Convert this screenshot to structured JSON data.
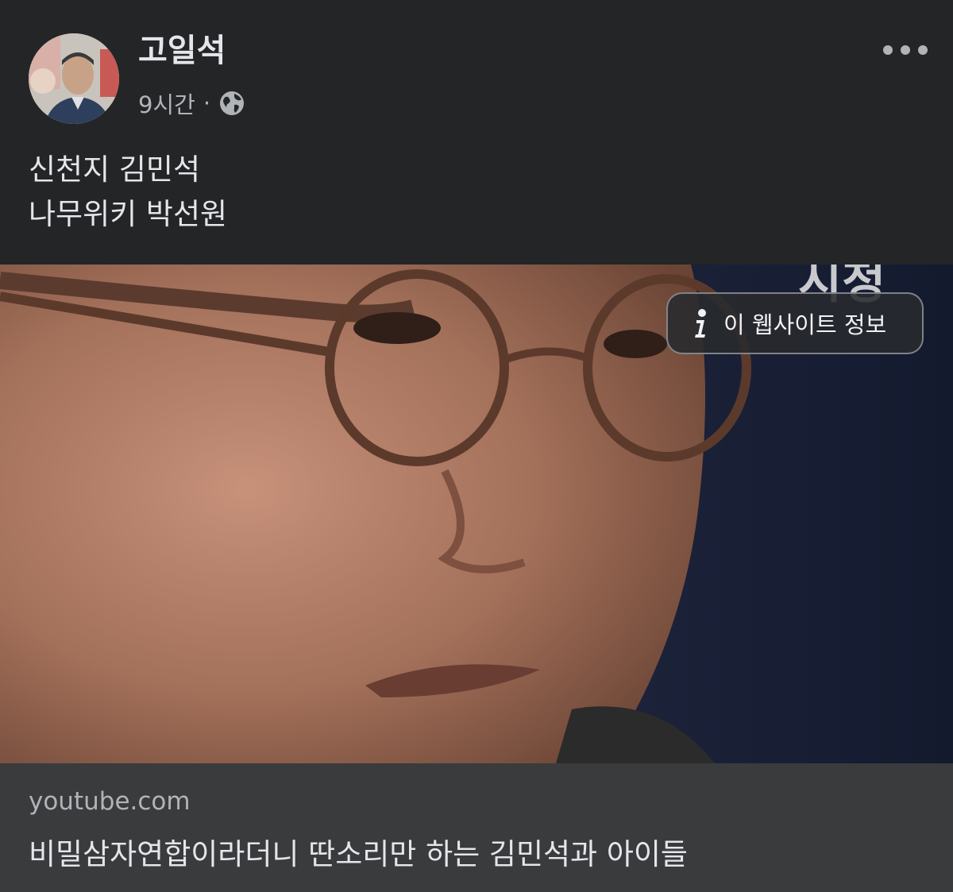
{
  "post": {
    "author": {
      "name": "고일석"
    },
    "meta": {
      "timestamp": "9시간",
      "separator": "·",
      "audience_icon": "globe-icon"
    },
    "more_icon": "more-horizontal-icon",
    "text_lines": [
      "신천지 김민석",
      "나무위키 박선원"
    ],
    "link_preview": {
      "info_button_label": "이 웹사이트 정보",
      "info_icon": "info-icon",
      "domain": "youtube.com",
      "title": "비밀삼자연합이라더니 딴소리만 하는 김민석과 아이들"
    }
  },
  "colors": {
    "background": "#242527",
    "footer_background": "#3a3b3d",
    "primary_text": "#e4e6eb",
    "secondary_text": "#b0b3b8"
  }
}
